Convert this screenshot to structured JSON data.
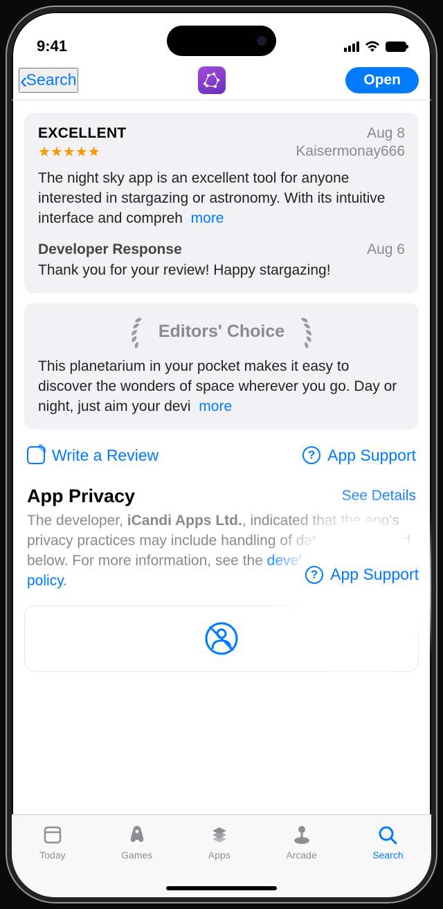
{
  "status": {
    "time": "9:41"
  },
  "nav": {
    "back_label": "Search",
    "open_label": "Open"
  },
  "review": {
    "title": "EXCELLENT",
    "date": "Aug 8",
    "author": "Kaisermonay666",
    "stars": "★★★★★",
    "body": "The night sky app is an excellent tool for anyone interested in stargazing or astronomy. With its intuitive interface and compreh",
    "more": "more",
    "dev_title": "Developer Response",
    "dev_date": "Aug 6",
    "dev_body": "Thank you for your review! Happy stargazing!"
  },
  "editors": {
    "title": "Editors' Choice",
    "body": "This planetarium in your pocket makes it easy to discover the wonders of space wherever you go. Day or night, just aim your devi",
    "more": "more"
  },
  "actions": {
    "write_review": "Write a Review",
    "app_support": "App Support"
  },
  "privacy": {
    "title": "App Privacy",
    "see_details": "See Details",
    "body_pre": "The developer, ",
    "dev_name": "iCandi Apps Ltd.",
    "body_mid": ", indicated that the app's privacy practices may include handling of data as described below. For more information, see the ",
    "link": "developer's privacy policy",
    "body_post": "."
  },
  "tabs": {
    "today": "Today",
    "games": "Games",
    "apps": "Apps",
    "arcade": "Arcade",
    "search": "Search"
  }
}
